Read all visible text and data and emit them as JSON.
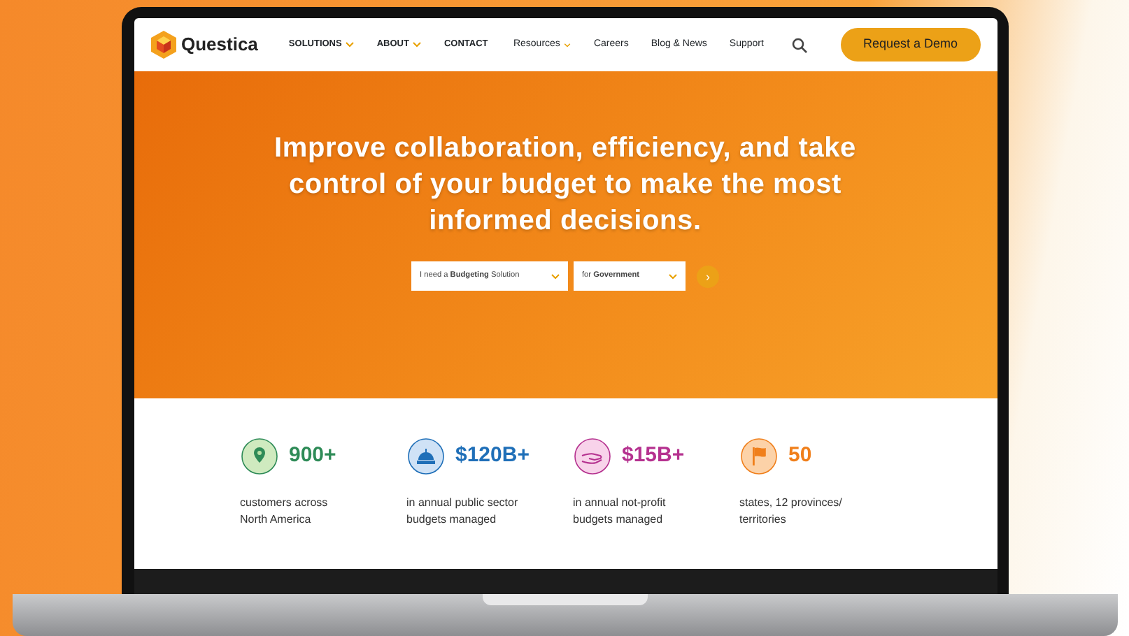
{
  "nav": {
    "brand": "Questica",
    "menu": [
      {
        "label": "SOLUTIONS",
        "dropdown": true
      },
      {
        "label": "ABOUT",
        "dropdown": true
      },
      {
        "label": "CONTACT",
        "dropdown": false
      }
    ],
    "links": [
      {
        "label": "Resources",
        "dropdown": true
      },
      {
        "label": "Careers",
        "dropdown": false
      },
      {
        "label": "Blog & News",
        "dropdown": false
      },
      {
        "label": "Support",
        "dropdown": false
      }
    ],
    "cta": "Request a Demo"
  },
  "hero": {
    "headline": "Improve collaboration, efficiency, and take control of your budget to make the most informed decisions.",
    "selects": [
      "I need a **Budgeting** Solution",
      "for **Government**"
    ],
    "go": "›"
  },
  "stats": [
    {
      "kind": "pin",
      "value": "900+",
      "caption": "customers across North America",
      "color": "#2e8b57"
    },
    {
      "kind": "dome",
      "value": "$120B+",
      "caption": "in annual public sector budgets managed",
      "color": "#1f6fb8"
    },
    {
      "kind": "hand",
      "value": "$15B+",
      "caption": "in annual not-profit budgets managed",
      "color": "#b5318f"
    },
    {
      "kind": "flag",
      "value": "50",
      "caption": "states, 12 provinces/ territories",
      "color": "#f07f1b"
    }
  ]
}
